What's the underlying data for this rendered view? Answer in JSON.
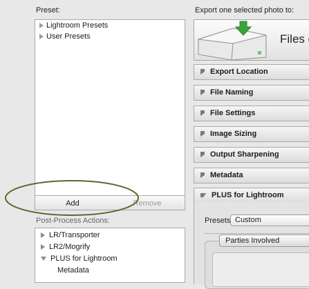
{
  "labels": {
    "preset": "Preset:",
    "export_title": "Export one selected photo to:",
    "post_process": "Post-Process Actions:"
  },
  "preset_list": {
    "items": [
      {
        "label": "Lightroom Presets"
      },
      {
        "label": "User Presets"
      }
    ]
  },
  "buttons": {
    "add": "Add",
    "remove": "Remove"
  },
  "ppa_list": {
    "items": [
      {
        "label": "LR/Transporter",
        "expanded": false
      },
      {
        "label": "LR2/Mogrify",
        "expanded": false
      },
      {
        "label": "PLUS for Lightroom",
        "expanded": true
      },
      {
        "label": "Metadata",
        "checked": true
      }
    ]
  },
  "banner": {
    "text": "Files on"
  },
  "sections": [
    {
      "label": "Export Location",
      "expanded": false
    },
    {
      "label": "File Naming",
      "expanded": false
    },
    {
      "label": "File Settings",
      "expanded": false
    },
    {
      "label": "Image Sizing",
      "expanded": false
    },
    {
      "label": "Output Sharpening",
      "expanded": false
    },
    {
      "label": "Metadata",
      "expanded": false
    },
    {
      "label": "PLUS for Lightroom",
      "expanded": true
    }
  ],
  "plus_panel": {
    "presets_label": "Presets:",
    "presets_value": "Custom",
    "tab_label": "Parties Involved"
  },
  "colors": {
    "annotation_ellipse": "#556b2f",
    "arrow_green": "#3aa63a"
  }
}
